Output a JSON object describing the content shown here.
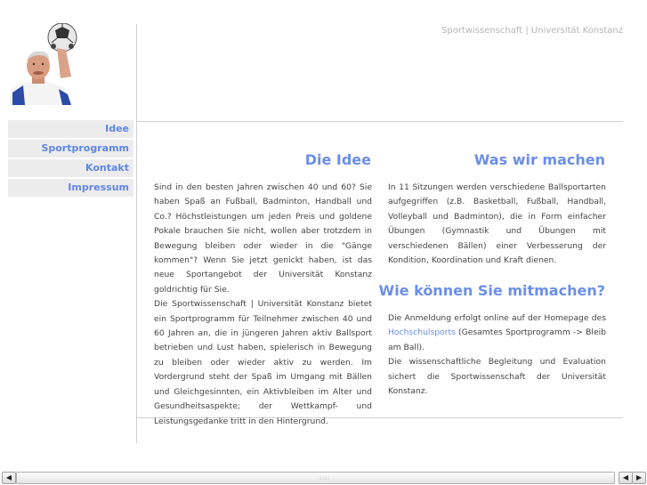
{
  "header": {
    "site_title": "Sportwissenschaft | Universität Konstanz",
    "photo_alt": "player-photo"
  },
  "nav": {
    "items": [
      {
        "label": "Idee"
      },
      {
        "label": "Sportprogramm"
      },
      {
        "label": "Kontakt"
      },
      {
        "label": "Impressum"
      }
    ]
  },
  "content": {
    "idee": {
      "heading": "Die Idee",
      "p1": "Sind in den besten Jahren zwischen 40 und 60? Sie haben Spaß an Fußball, Badminton, Handball und Co.? Höchstleistungen um jeden Preis und goldene Pokale brauchen Sie nicht, wollen aber trotzdem in Bewegung bleiben oder wieder in die \"Gänge kommen\"? Wenn Sie jetzt genickt haben, ist das neue Sportangebot der Universität Konstanz goldrichtig für Sie.",
      "p2": "Die Sportwissenschaft | Universität Konstanz bietet ein Sportprogramm für Teilnehmer zwischen 40 und 60 Jahren an, die in jüngeren Jahren aktiv Ballsport betrieben und Lust haben, spielerisch in Bewegung zu bleiben oder wieder aktiv zu werden. Im Vordergrund steht der Spaß im Umgang mit Bällen und Gleichgesinnten, ein Aktivbleiben im Alter und Gesundheitsaspekte; der Wettkampf- und Leistungsgedanke tritt in den Hintergrund."
    },
    "was": {
      "heading": "Was wir machen",
      "p1": "In 11 Sitzungen werden verschiedene Ballsportarten aufgegriffen (z.B. Basketball, Fußball, Handball, Volleyball und Badminton), die in Form einfacher Übungen (Gymnastik und Übungen mit verschiedenen Bällen) einer Verbesserung der Kondition, Koordination und Kraft dienen."
    },
    "wie": {
      "heading": "Wie können Sie mitmachen?",
      "p1_before": "Die Anmeldung erfolgt online auf der Homepage des ",
      "p1_link": "Hochschulsports",
      "p1_after": " (Gesamtes Sportprogramm -> Bleib am Ball).",
      "p2": "Die wissenschaftliche Begleitung und Evaluation sichert die Sportwissenschaft der Universität Konstanz."
    }
  },
  "scrollbar": {
    "left_arrow": "◀",
    "right_arrow": "▶",
    "grip": "::::"
  },
  "colors": {
    "accent": "#6b8ee8",
    "nav_bg": "#ececec",
    "rule": "#cfcfcf",
    "muted": "#b5b5b5"
  }
}
